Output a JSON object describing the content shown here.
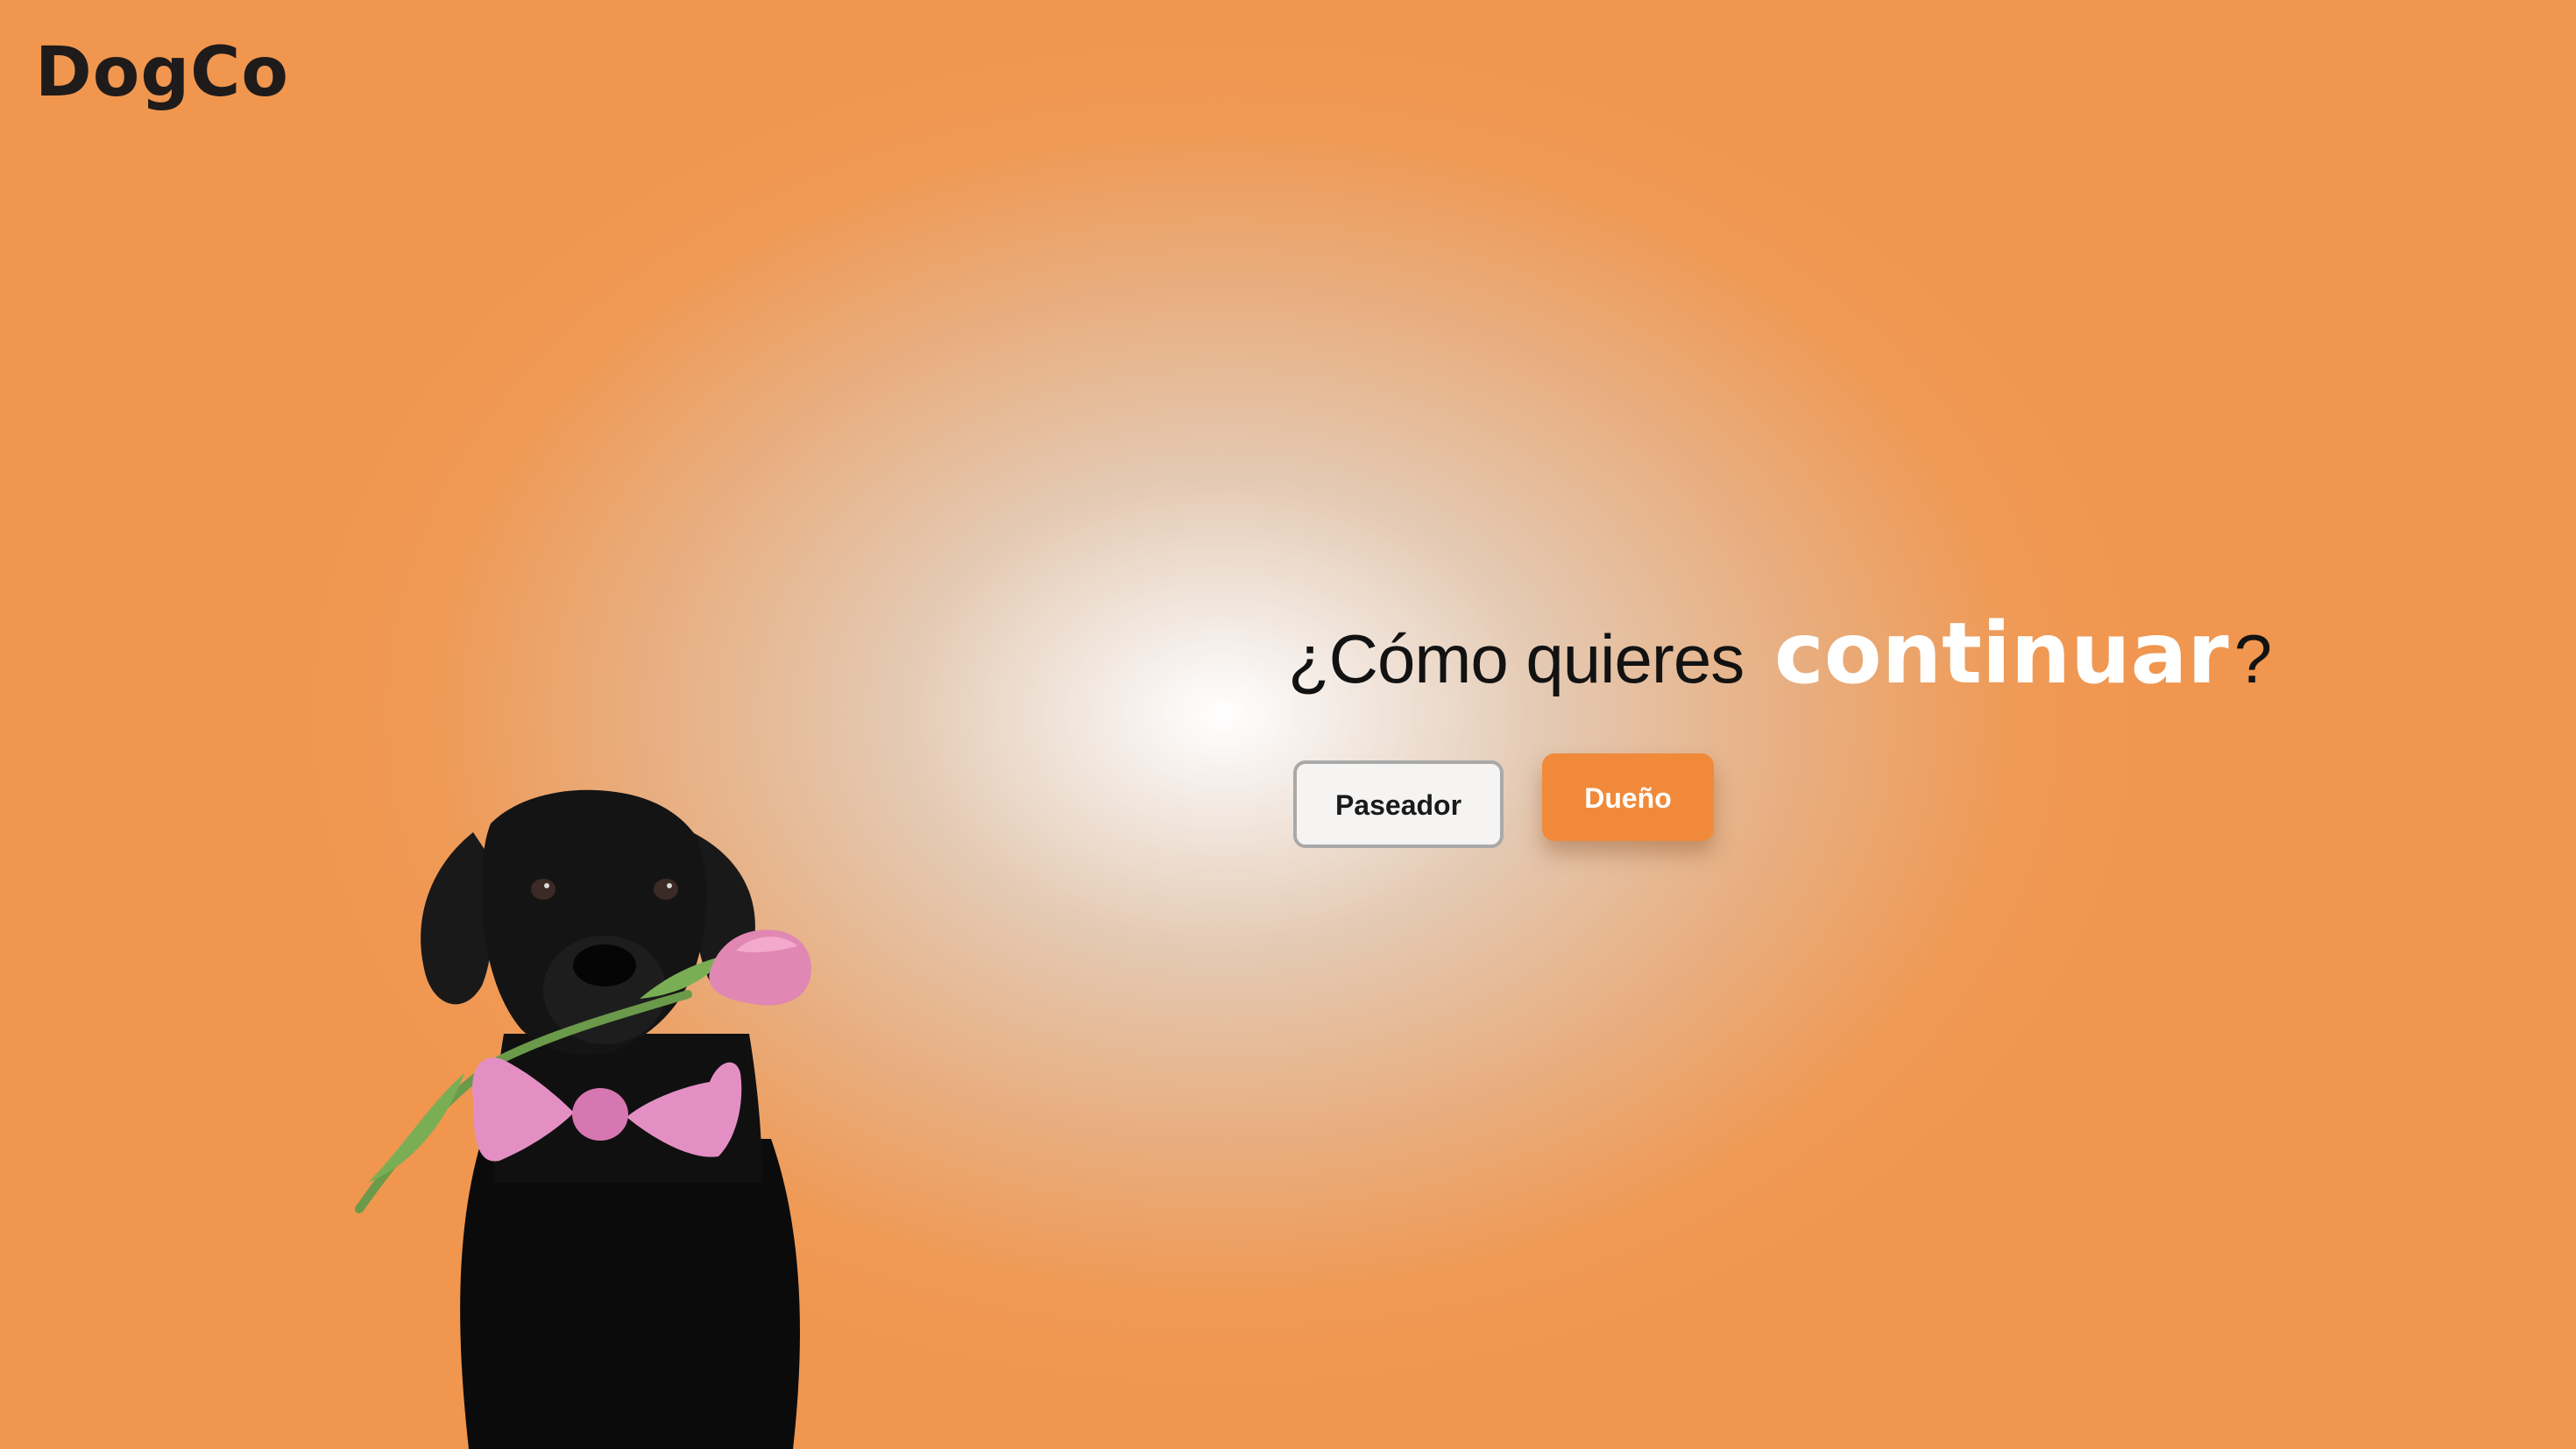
{
  "brand": {
    "logo_text": "DogCo"
  },
  "hero": {
    "question_prefix": "¿Cómo quieres ",
    "question_highlight": "continuar",
    "question_suffix": "?"
  },
  "actions": {
    "walker_label": "Paseador",
    "owner_label": "Dueño"
  },
  "colors": {
    "background_edge": "#f0964f",
    "background_center": "#ffffff",
    "accent": "#f08a3a",
    "text_dark": "#121212"
  },
  "illustration": {
    "icon": "dog-with-tulip-and-bowtie"
  }
}
